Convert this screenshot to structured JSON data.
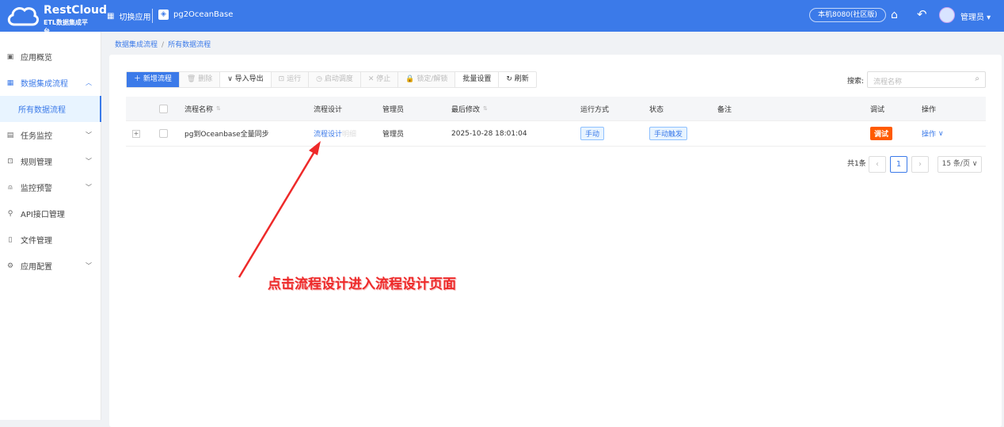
{
  "header": {
    "brand": "RestCloud",
    "brand_sub": "ETL数据集成平台",
    "switch_app": "切换应用",
    "project": "pg2OceanBase",
    "env": "本机8080(社区版)",
    "user": "管理员"
  },
  "sidebar": {
    "items": [
      {
        "label": "应用概览"
      },
      {
        "label": "数据集成流程"
      },
      {
        "label": "所有数据流程"
      },
      {
        "label": "任务监控"
      },
      {
        "label": "规则管理"
      },
      {
        "label": "监控预警"
      },
      {
        "label": "API接口管理"
      },
      {
        "label": "文件管理"
      },
      {
        "label": "应用配置"
      }
    ]
  },
  "breadcrumb": [
    "数据集成流程",
    "所有数据流程"
  ],
  "toolbar": {
    "new": "新增流程",
    "delete": "删除",
    "import_export": "导入导出",
    "run": "运行",
    "schedule": "启动调度",
    "stop": "停止",
    "lock": "锁定/解锁",
    "batch": "批量设置",
    "refresh": "刷新"
  },
  "search": {
    "label": "搜索:",
    "placeholder": "流程名称"
  },
  "table": {
    "columns": [
      "流程名称",
      "流程设计",
      "管理员",
      "最后修改",
      "运行方式",
      "状态",
      "备注",
      "调试",
      "操作"
    ],
    "rows": [
      {
        "name": "pg到Oceanbase全量同步",
        "design": "流程设计",
        "design_extra": "明细",
        "admin": "管理员",
        "modified": "2025-10-28 18:01:04",
        "run_mode": "手动",
        "status": "手动触发",
        "remark": "",
        "debug": "调试",
        "action": "操作"
      }
    ]
  },
  "pagination": {
    "total": "共1条",
    "page": "1",
    "size": "15 条/页"
  },
  "annotation": "点击流程设计进入流程设计页面"
}
